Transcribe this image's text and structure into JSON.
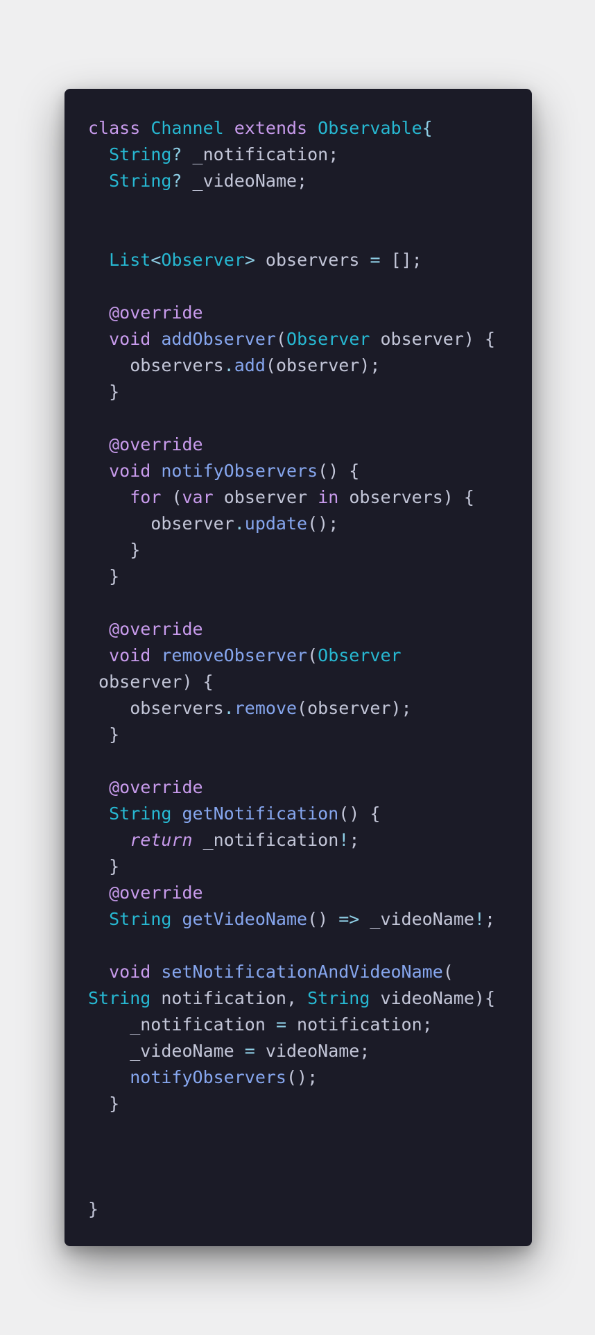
{
  "code_block": {
    "language": "dart",
    "colors": {
      "background": "#1b1b27",
      "keyword": "#c89bec",
      "type": "#27b8d2",
      "function": "#86a6ee",
      "operator": "#8fcfe6",
      "text": "#c3c6d8"
    },
    "lines": [
      [
        [
          "kw",
          "class "
        ],
        [
          "type",
          "Channel "
        ],
        [
          "kw",
          "extends "
        ],
        [
          "type",
          "Observable"
        ],
        [
          "br",
          "{"
        ]
      ],
      [
        [
          "var",
          "  "
        ],
        [
          "type",
          "String"
        ],
        [
          "op",
          "? "
        ],
        [
          "var",
          "_notification;"
        ]
      ],
      [
        [
          "var",
          "  "
        ],
        [
          "type",
          "String"
        ],
        [
          "op",
          "? "
        ],
        [
          "var",
          "_videoName;"
        ]
      ],
      [],
      [],
      [
        [
          "var",
          "  "
        ],
        [
          "type",
          "List"
        ],
        [
          "op",
          "<"
        ],
        [
          "type",
          "Observer"
        ],
        [
          "op",
          "> "
        ],
        [
          "var",
          "observers "
        ],
        [
          "op",
          "= "
        ],
        [
          "var",
          "[];"
        ]
      ],
      [],
      [
        [
          "var",
          "  "
        ],
        [
          "dec",
          "@override"
        ]
      ],
      [
        [
          "var",
          "  "
        ],
        [
          "kw",
          "void "
        ],
        [
          "fn",
          "addObserver"
        ],
        [
          "var",
          "("
        ],
        [
          "type",
          "Observer "
        ],
        [
          "var",
          "observer) {"
        ]
      ],
      [
        [
          "var",
          "    observers"
        ],
        [
          "op",
          "."
        ],
        [
          "fn",
          "add"
        ],
        [
          "var",
          "(observer);"
        ]
      ],
      [
        [
          "var",
          "  }"
        ]
      ],
      [],
      [
        [
          "var",
          "  "
        ],
        [
          "dec",
          "@override"
        ]
      ],
      [
        [
          "var",
          "  "
        ],
        [
          "kw",
          "void "
        ],
        [
          "fn",
          "notifyObservers"
        ],
        [
          "var",
          "() {"
        ]
      ],
      [
        [
          "var",
          "    "
        ],
        [
          "kw",
          "for "
        ],
        [
          "var",
          "("
        ],
        [
          "kw",
          "var "
        ],
        [
          "var",
          "observer "
        ],
        [
          "kw",
          "in "
        ],
        [
          "var",
          "observers) {"
        ]
      ],
      [
        [
          "var",
          "      observer"
        ],
        [
          "op",
          "."
        ],
        [
          "fn",
          "update"
        ],
        [
          "var",
          "();"
        ]
      ],
      [
        [
          "var",
          "    }"
        ]
      ],
      [
        [
          "var",
          "  }"
        ]
      ],
      [],
      [
        [
          "var",
          "  "
        ],
        [
          "dec",
          "@override"
        ]
      ],
      [
        [
          "var",
          "  "
        ],
        [
          "kw",
          "void "
        ],
        [
          "fn",
          "removeObserver"
        ],
        [
          "var",
          "("
        ],
        [
          "type",
          "Observer"
        ]
      ],
      [
        [
          "var",
          " observer) {"
        ]
      ],
      [
        [
          "var",
          "    observers"
        ],
        [
          "op",
          "."
        ],
        [
          "fn",
          "remove"
        ],
        [
          "var",
          "(observer);"
        ]
      ],
      [
        [
          "var",
          "  }"
        ]
      ],
      [],
      [
        [
          "var",
          "  "
        ],
        [
          "dec",
          "@override"
        ]
      ],
      [
        [
          "var",
          "  "
        ],
        [
          "type",
          "String "
        ],
        [
          "fn",
          "getNotification"
        ],
        [
          "var",
          "() {"
        ]
      ],
      [
        [
          "var",
          "    "
        ],
        [
          "it",
          "return "
        ],
        [
          "var",
          "_notification"
        ],
        [
          "op",
          "!"
        ],
        [
          "var",
          ";"
        ]
      ],
      [
        [
          "var",
          "  }"
        ]
      ],
      [
        [
          "var",
          "  "
        ],
        [
          "dec",
          "@override"
        ]
      ],
      [
        [
          "var",
          "  "
        ],
        [
          "type",
          "String "
        ],
        [
          "fn",
          "getVideoName"
        ],
        [
          "var",
          "() "
        ],
        [
          "op",
          "=> "
        ],
        [
          "var",
          "_videoName"
        ],
        [
          "op",
          "!"
        ],
        [
          "var",
          ";"
        ]
      ],
      [],
      [
        [
          "var",
          "  "
        ],
        [
          "kw",
          "void "
        ],
        [
          "fn",
          "setNotificationAndVideoName"
        ],
        [
          "var",
          "("
        ]
      ],
      [
        [
          "type",
          "String "
        ],
        [
          "var",
          "notification, "
        ],
        [
          "type",
          "String "
        ],
        [
          "var",
          "videoName){"
        ]
      ],
      [
        [
          "var",
          "    _notification "
        ],
        [
          "op",
          "= "
        ],
        [
          "var",
          "notification;"
        ]
      ],
      [
        [
          "var",
          "    _videoName "
        ],
        [
          "op",
          "= "
        ],
        [
          "var",
          "videoName;"
        ]
      ],
      [
        [
          "var",
          "    "
        ],
        [
          "fn",
          "notifyObservers"
        ],
        [
          "var",
          "();"
        ]
      ],
      [
        [
          "var",
          "  }"
        ]
      ],
      [],
      [],
      [],
      [
        [
          "var",
          "}"
        ]
      ]
    ]
  }
}
